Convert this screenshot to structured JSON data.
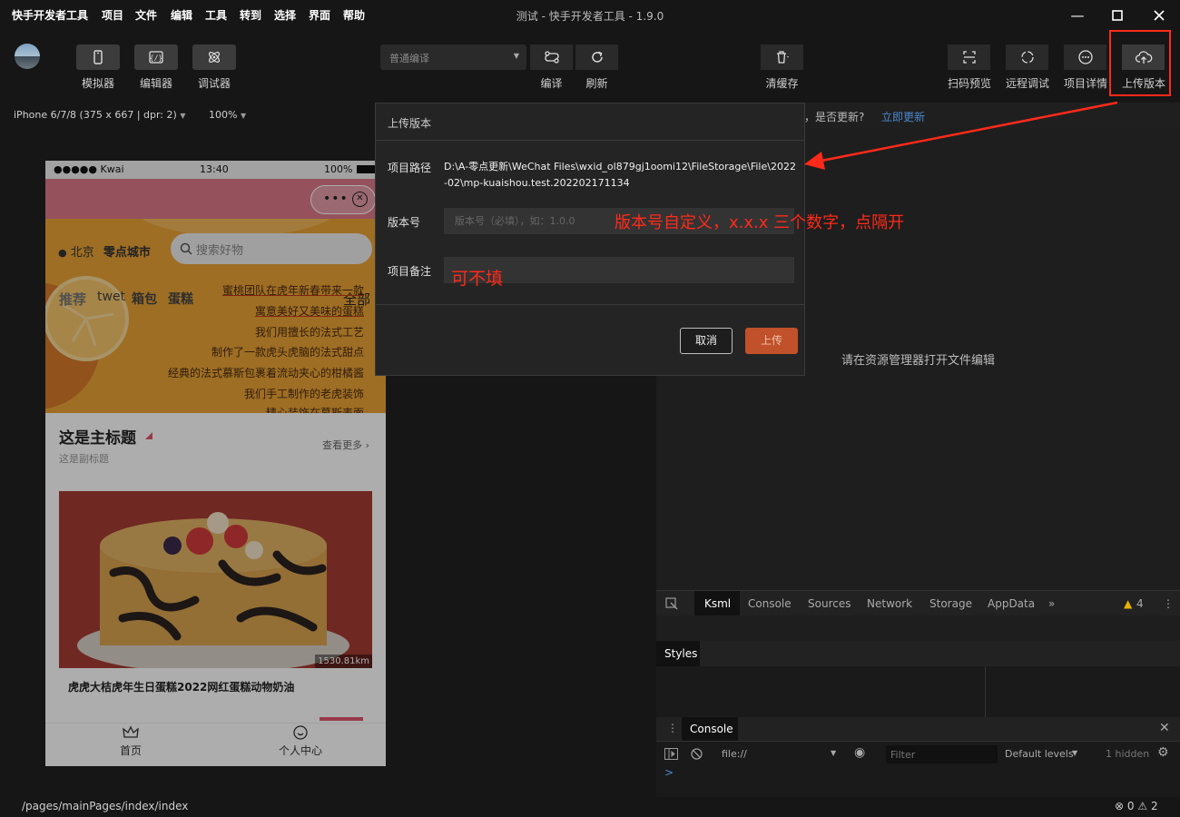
{
  "menubar": {
    "app_name": "快手开发者工具",
    "items": [
      "项目",
      "文件",
      "编辑",
      "工具",
      "转到",
      "选择",
      "界面",
      "帮助"
    ],
    "window_title": "测试 - 快手开发者工具 - 1.9.0"
  },
  "toolbar": {
    "simulator_label": "模拟器",
    "editor_label": "编辑器",
    "debugger_label": "调试器",
    "compile_mode": "普通编译",
    "compile_label": "编译",
    "refresh_label": "刷新",
    "clear_cache_label": "清缓存",
    "scan_preview_label": "扫码预览",
    "remote_debug_label": "远程调试",
    "project_details_label": "项目详情",
    "upload_version_label": "上传版本"
  },
  "subbar": {
    "device": "iPhone 6/7/8 (375 x 667 | dpr: 2)",
    "zoom": "100%",
    "update_question": "，是否更新?",
    "update_link": "立即更新"
  },
  "phone": {
    "carrier": "●●●●● Kwai",
    "time": "13:40",
    "battery": "100%",
    "location": "北京",
    "city_name": "零点城市",
    "search_placeholder": "搜索好物",
    "categories": [
      "推荐",
      "twet",
      "箱包",
      "蛋糕"
    ],
    "all_label": "全部",
    "scroll_lines": [
      "蜜桃团队在虎年新春带来一款",
      "寓意美好又美味的蛋糕",
      "我们用擅长的法式工艺",
      "制作了一款虎头虎脑的法式甜点",
      "经典的法式慕斯包裹着流动夹心的柑橘酱",
      "我们手工制作的老虎装饰",
      "精心装饰在慕斯表面"
    ],
    "section_title": "这是主标题",
    "section_subtitle": "这是副标题",
    "see_more": "查看更多",
    "distance": "1530.81km",
    "product_name": "虎虎大桔虎年生日蛋糕2022网红蛋糕动物奶油",
    "tab_home": "首页",
    "tab_profile": "个人中心"
  },
  "editor": {
    "hint": "请在资源管理器打开文件编辑"
  },
  "devtools": {
    "tabs": [
      "Ksml",
      "Console",
      "Sources",
      "Network",
      "Storage",
      "AppData"
    ],
    "warning_count": "4",
    "styles_tab": "Styles",
    "console_tab": "Console",
    "context": "file://",
    "filter_placeholder": "Filter",
    "levels": "Default levels",
    "hidden": "1 hidden",
    "prompt": ">"
  },
  "modal": {
    "title": "上传版本",
    "path_label": "项目路径",
    "path_value": "D:\\A-零点更新\\WeChat Files\\wxid_ol879gj1oomi12\\FileStorage\\File\\2022-02\\mp-kuaishou.test.202202171134",
    "version_label": "版本号",
    "version_placeholder": "版本号（必填），如：1.0.0",
    "note_label": "项目备注",
    "cancel": "取消",
    "upload": "上传"
  },
  "annotations": {
    "version_hint": "版本号自定义，x.x.x 三个数字，点隔开",
    "note_hint": "可不填",
    "color": "#ff2a1a"
  },
  "statusbar": {
    "path": "/pages/mainPages/index/index",
    "errors": "0",
    "warnings": "2"
  }
}
